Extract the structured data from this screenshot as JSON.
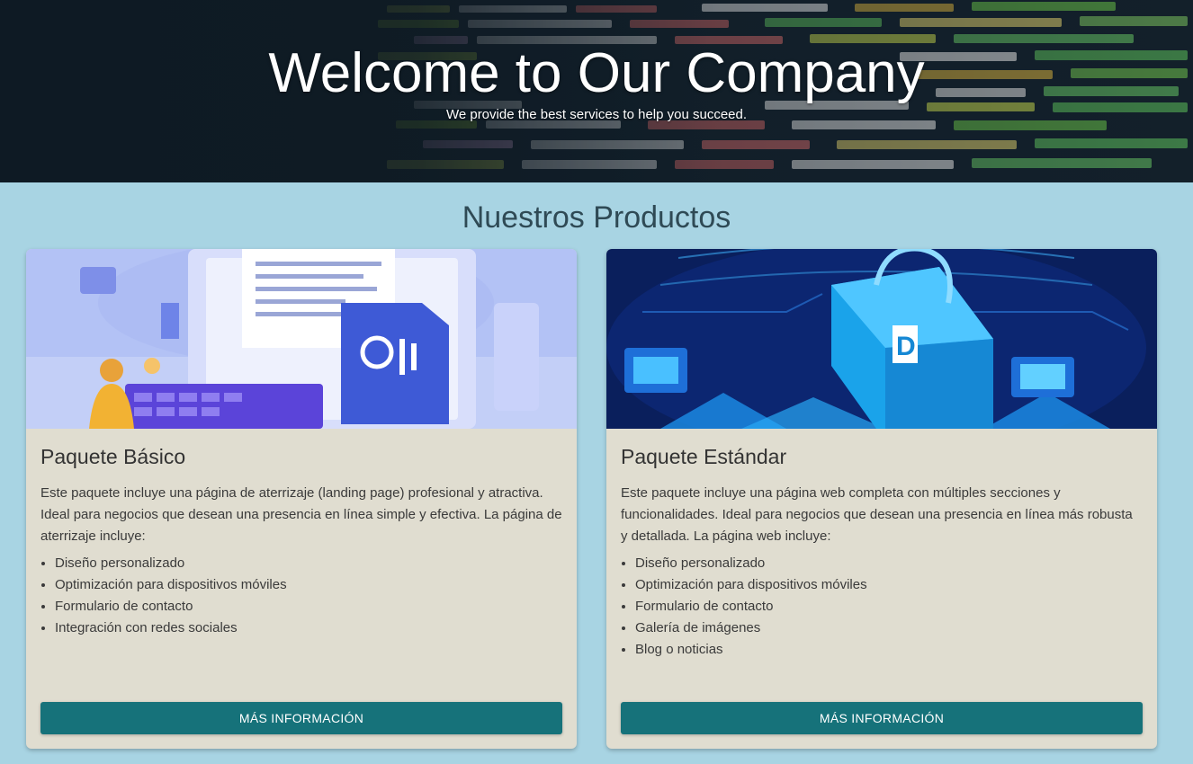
{
  "hero": {
    "title": "Welcome to Our Company",
    "subtitle": "We provide the best services to help you succeed."
  },
  "products": {
    "heading": "Nuestros Productos",
    "cards": [
      {
        "title": "Paquete Básico",
        "description": "Este paquete incluye una página de aterrizaje (landing page) profesional y atractiva. Ideal para negocios que desean una presencia en línea simple y efectiva. La página de aterrizaje incluye:",
        "features": [
          "Diseño personalizado",
          "Optimización para dispositivos móviles",
          "Formulario de contacto",
          "Integración con redes sociales"
        ],
        "button_label": "MÁS INFORMACIÓN"
      },
      {
        "title": "Paquete Estándar",
        "description": "Este paquete incluye una página web completa con múltiples secciones y funcionalidades. Ideal para negocios que desean una presencia en línea más robusta y detallada. La página web incluye:",
        "features": [
          "Diseño personalizado",
          "Optimización para dispositivos móviles",
          "Formulario de contacto",
          "Galería de imágenes",
          "Blog o noticias"
        ],
        "button_label": "MÁS INFORMACIÓN"
      }
    ]
  },
  "colors": {
    "page_background": "#a8d4e3",
    "card_background": "#e0ddd0",
    "button": "#16727a"
  }
}
